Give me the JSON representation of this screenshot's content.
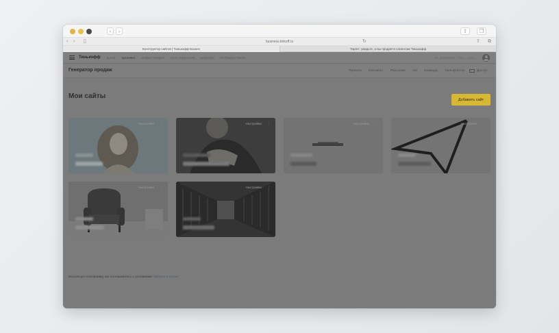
{
  "browser": {
    "url": "business.tinkoff.ru",
    "tabs": [
      "Конструктор сайтов | Тинькофф Бизнес",
      "Таргет: увидьте, а вы продаёте клиентам Тинькофф"
    ]
  },
  "brand": "Тинькофф",
  "topnav": [
    "БАНК",
    "БИЗНЕС",
    "ИНВЕСТИЦИИ",
    "СТРАХОВАНИЕ",
    "МОБАЙЛ",
    "ПУТЕШЕСТВИЯ"
  ],
  "account_label": "ИП ВОРОНОВ · ООО · БАН...",
  "app_title": "Генератор продаж",
  "subnav": [
    "Проекты",
    "Контакты",
    "Рассылки",
    "Чат",
    "Команда",
    "Калькулятор",
    "Доступ"
  ],
  "page_title": "Мои сайты",
  "add_site_button": "Добавить сайт",
  "card_settings_label": "Настройки",
  "cards": [
    {
      "image": "woman-portrait-photo"
    },
    {
      "image": "woman-dark-portrait-photo"
    },
    {
      "image": "logo-placeholder"
    },
    {
      "image": "cursor-arrow-graphic"
    },
    {
      "image": "armchair-photo"
    },
    {
      "image": "bookshelf-corridor-photo"
    }
  ],
  "footer": {
    "text": "Используя платформу, вы соглашаетесь с условиями ",
    "link": "оферты и лицен"
  },
  "colors": {
    "accent": "#FFDD2D",
    "overlay": "#7B7B7B"
  }
}
